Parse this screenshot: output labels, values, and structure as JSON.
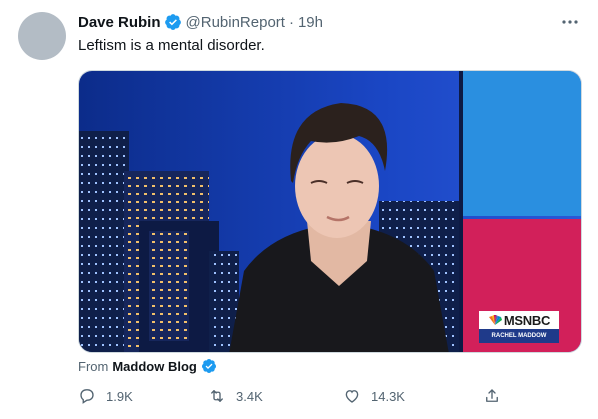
{
  "tweet": {
    "author_name": "Dave Rubin",
    "author_handle": "@RubinReport",
    "separator": "·",
    "time": "19h",
    "text": "Leftism is a mental disorder.",
    "media_channel_logo": "MSNBC",
    "media_channel_subtitle": "RACHEL MADDOW",
    "from_prefix": "From",
    "from_source": "Maddow Blog"
  },
  "actions": {
    "reply_count": "1.9K",
    "retweet_count": "3.4K",
    "like_count": "14.3K"
  },
  "icons": [
    "verified-badge-icon",
    "more-icon",
    "reply-icon",
    "retweet-icon",
    "like-icon",
    "share-icon"
  ],
  "colors": {
    "verified": "#1d9bf0",
    "text_primary": "#0f1419",
    "text_secondary": "#536471",
    "msnbc_bg": "#ffffff",
    "studio_blue": "#1336a6",
    "studio_pink": "#d2205a"
  }
}
